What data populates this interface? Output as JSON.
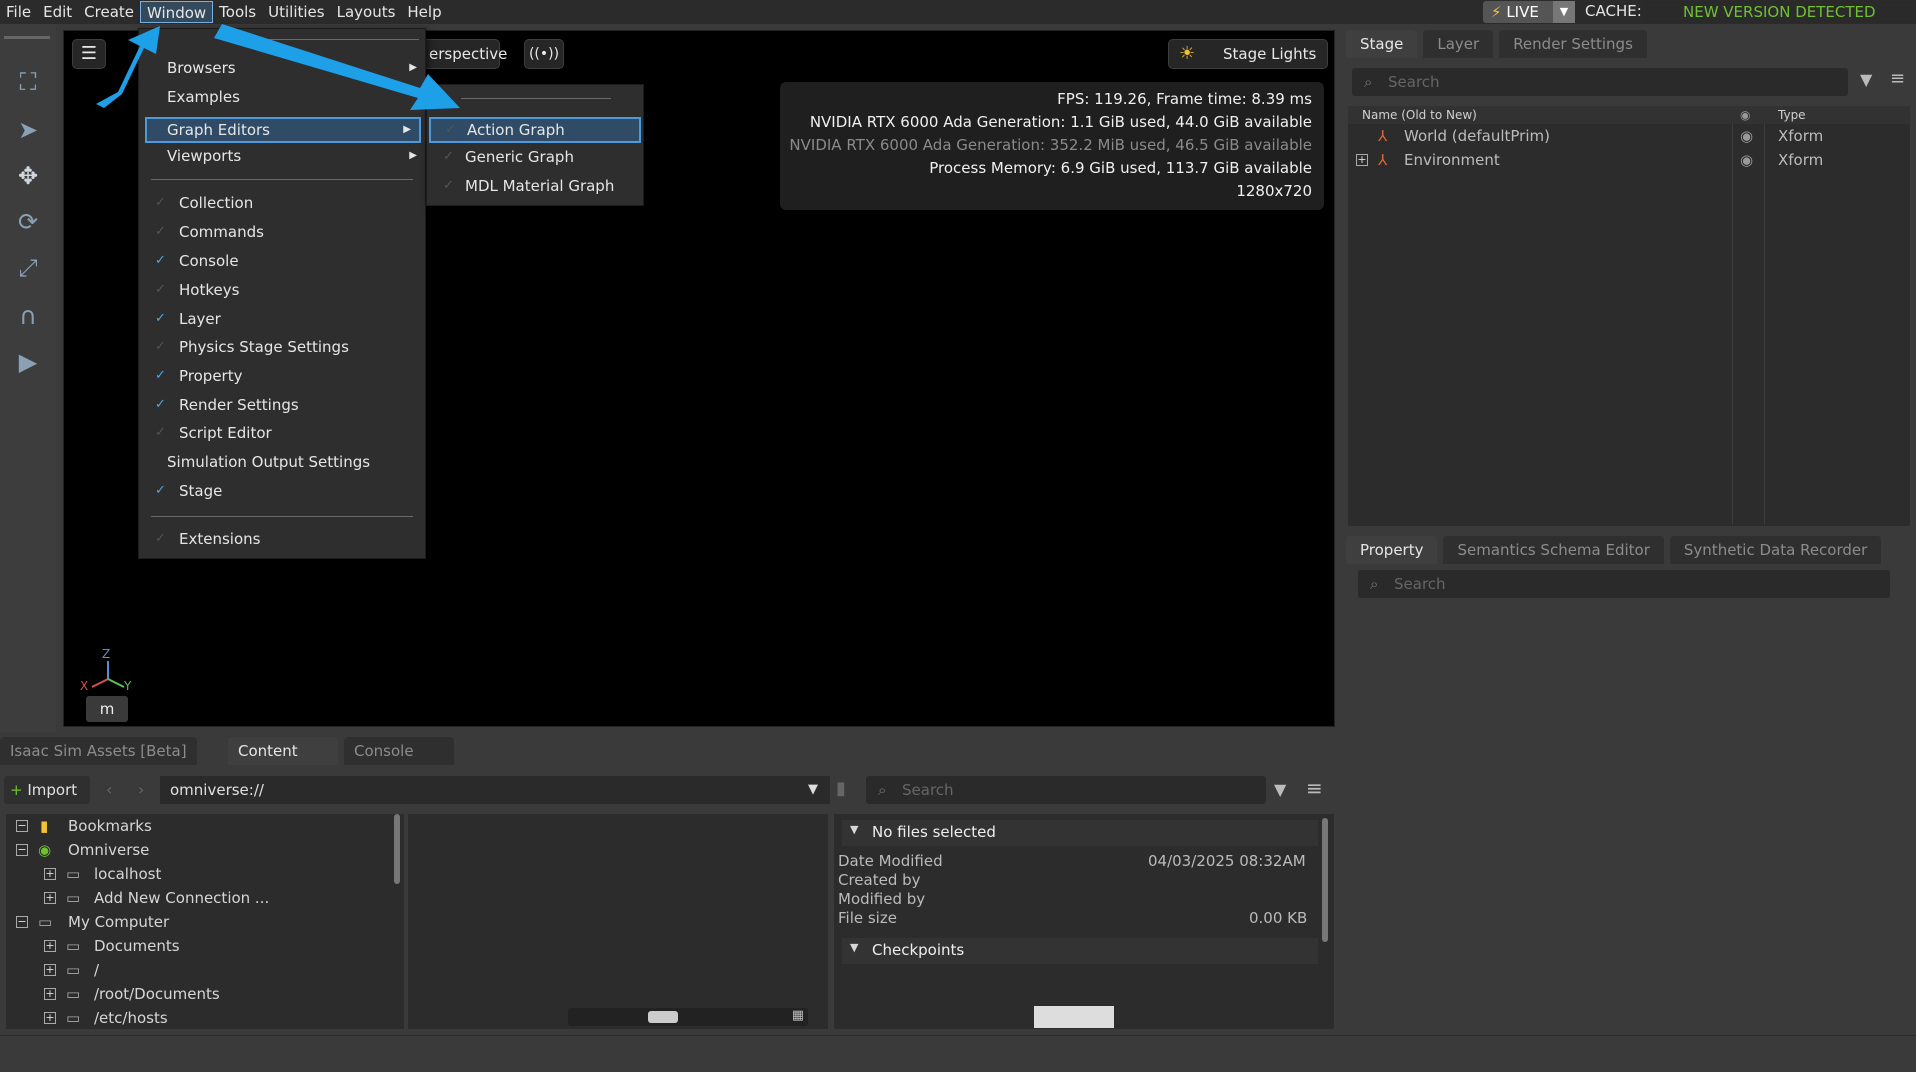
{
  "menubar": {
    "items": [
      "File",
      "Edit",
      "Create",
      "Window",
      "Tools",
      "Utilities",
      "Layouts",
      "Help"
    ],
    "live_label": "LIVE",
    "cache_label": "CACHE:",
    "new_version": "NEW VERSION DETECTED"
  },
  "window_menu": {
    "top_items": [
      "Browsers",
      "Examples",
      "Graph Editors",
      "Viewports"
    ],
    "checked_items": [
      {
        "label": "Collection",
        "checked": false
      },
      {
        "label": "Commands",
        "checked": false
      },
      {
        "label": "Console",
        "checked": true
      },
      {
        "label": "Hotkeys",
        "checked": false
      },
      {
        "label": "Layer",
        "checked": true
      },
      {
        "label": "Physics Stage Settings",
        "checked": false
      },
      {
        "label": "Property",
        "checked": true
      },
      {
        "label": "Render Settings",
        "checked": true
      },
      {
        "label": "Script Editor",
        "checked": false
      },
      {
        "label": "Simulation Output Settings",
        "checked": null
      },
      {
        "label": "Stage",
        "checked": true
      }
    ],
    "extensions": "Extensions"
  },
  "graph_submenu": {
    "items": [
      "Action Graph",
      "Generic Graph",
      "MDL Material Graph"
    ]
  },
  "viewport": {
    "perspective_label": "erspective",
    "stage_lights_label": "Stage Lights",
    "stats": {
      "fps": "FPS: 119.26, Frame time: 8.39 ms",
      "gpu1": "NVIDIA RTX 6000 Ada Generation: 1.1 GiB used, 44.0 GiB available",
      "gpu2": "NVIDIA RTX 6000 Ada Generation: 352.2 MiB used, 46.5 GiB available",
      "memory": "Process Memory: 6.9 GiB used, 113.7 GiB available",
      "resolution": "1280x720"
    },
    "axis_z": "Z",
    "axis_x": "X",
    "axis_y": "Y",
    "m_button": "m"
  },
  "stage_panel": {
    "tabs": [
      "Stage",
      "Layer",
      "Render Settings"
    ],
    "search_placeholder": "Search",
    "col_name": "Name (Old to New)",
    "col_type": "Type",
    "rows": [
      {
        "name": "World (defaultPrim)",
        "type": "Xform"
      },
      {
        "name": "Environment",
        "type": "Xform"
      }
    ]
  },
  "property_panel": {
    "tabs": [
      "Property",
      "Semantics Schema Editor",
      "Synthetic Data Recorder"
    ],
    "search_placeholder": "Search"
  },
  "bottom": {
    "tabs": [
      "Isaac Sim Assets [Beta]",
      "Content",
      "Console"
    ],
    "import_label": "Import",
    "path": "omniverse://",
    "search_placeholder": "Search",
    "tree": [
      {
        "label": "Bookmarks",
        "indent": 0
      },
      {
        "label": "Omniverse",
        "indent": 0
      },
      {
        "label": "localhost",
        "indent": 1
      },
      {
        "label": "Add New Connection ...",
        "indent": 1
      },
      {
        "label": "My Computer",
        "indent": 0
      },
      {
        "label": "Documents",
        "indent": 1
      },
      {
        "label": "/",
        "indent": 1
      },
      {
        "label": "/root/Documents",
        "indent": 1
      },
      {
        "label": "/etc/hosts",
        "indent": 1
      }
    ],
    "info": {
      "header": "No files selected",
      "date_label": "Date Modified",
      "date_value": "04/03/2025 08:32AM",
      "created_label": "Created by",
      "modified_label": "Modified by",
      "size_label": "File size",
      "size_value": "0.00 KB",
      "checkpoints": "Checkpoints"
    }
  },
  "colors": {
    "accent": "#47a9ea",
    "arrow": "#1ea0e8",
    "new_version": "#6fc132"
  }
}
